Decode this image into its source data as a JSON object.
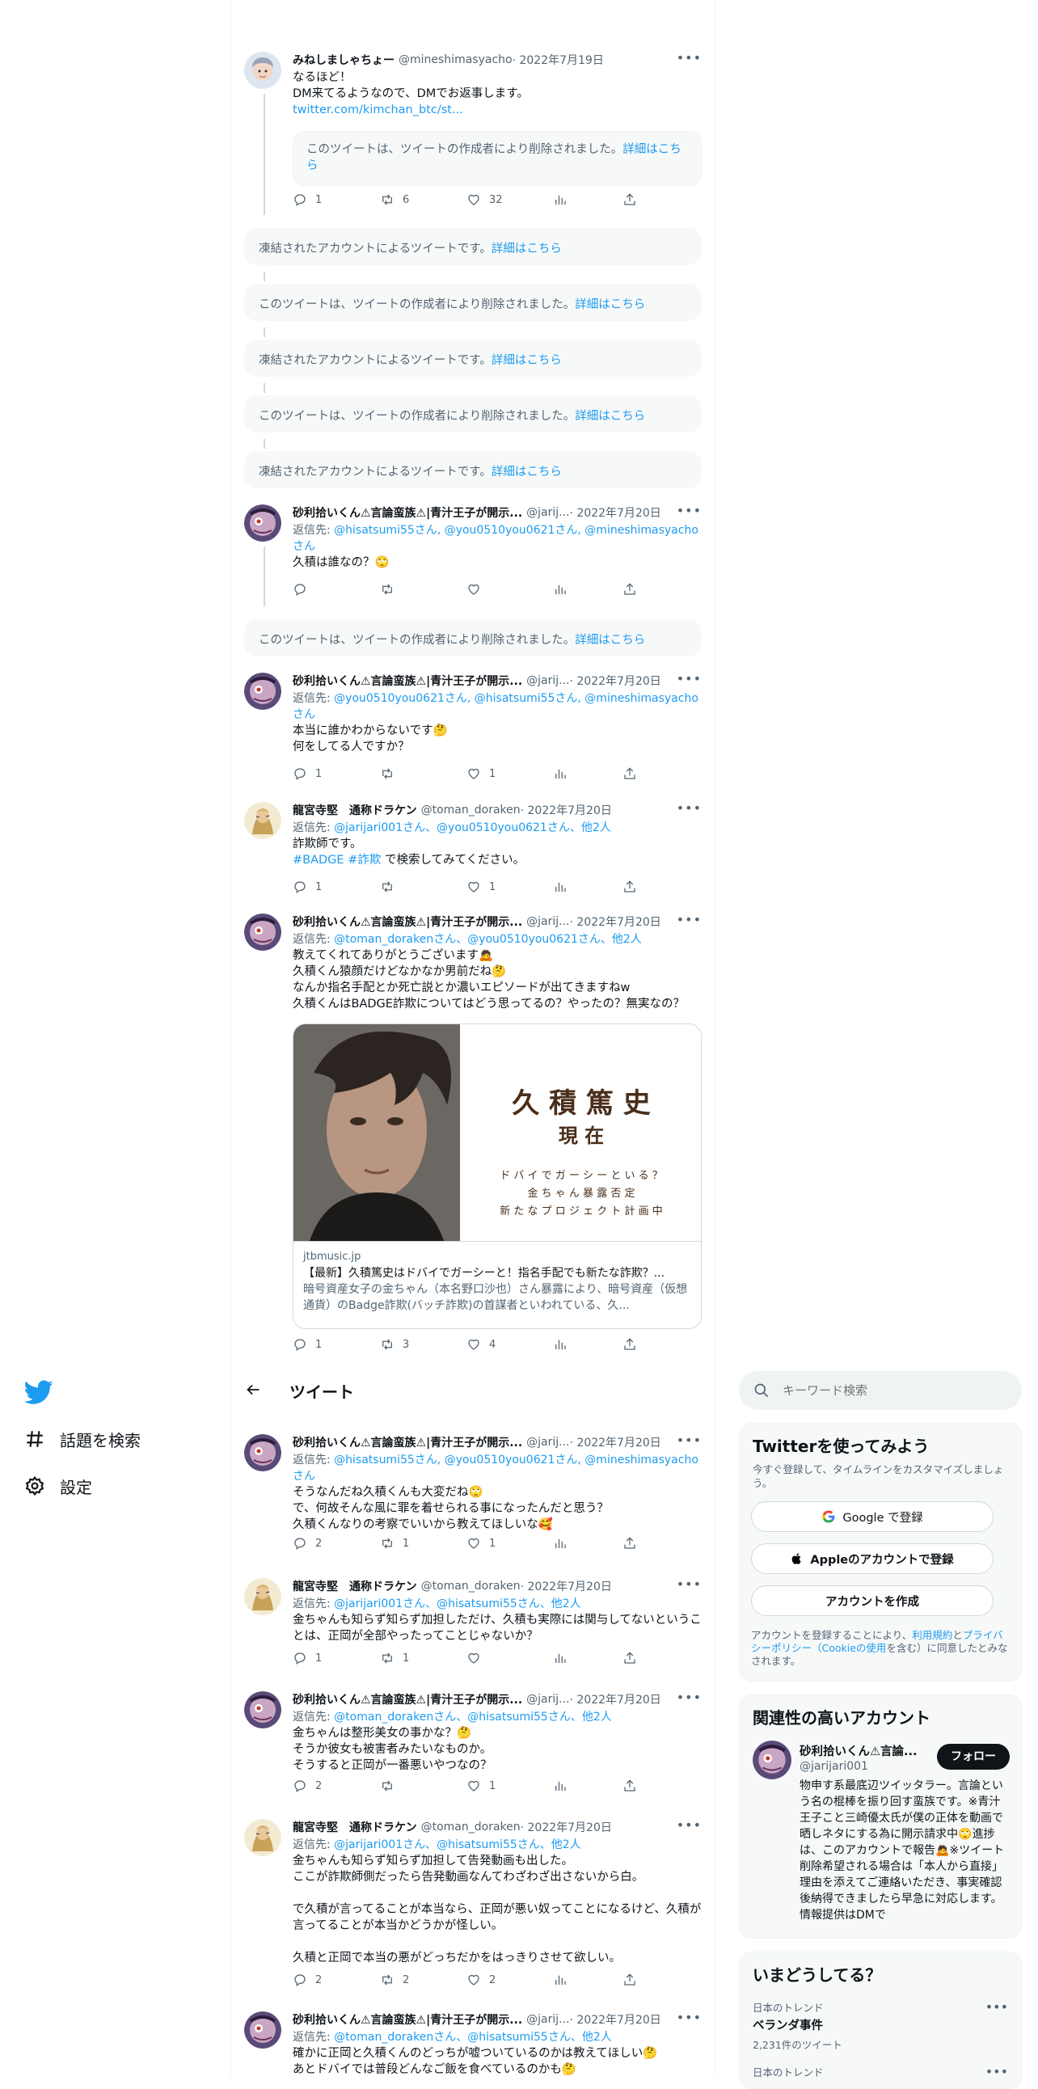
{
  "nav": {
    "explore_label": "話題を検索",
    "settings_label": "設定"
  },
  "header": {
    "title": "ツイート"
  },
  "search": {
    "placeholder": "キーワード検索"
  },
  "tweets": [
    {
      "name": "みねしましゃちょー",
      "handle": "@mineshimasyacho",
      "date": " · 2022年7月19日",
      "reply_to": "",
      "text": "なるほど！\nDM来てるようなので、DMでお返事します。",
      "link": "twitter.com/kimchan_btc/st...",
      "quoted": "このツイートは、ツイートの作成者により削除されました。",
      "quoted_link": "詳細はこちら",
      "replies": "1",
      "retweets": "6",
      "likes": "32"
    },
    {
      "name": "砂利拾いくん⚠言論蛮族⚠|青汁王子が開示...",
      "handle": "@jarij...",
      "date": " · 2022年7月20日",
      "reply_to": "@hisatsumi55さん, @you0510you0621さん, @mineshimasyachoさん",
      "text": "久積は誰なの？🙄",
      "replies": "",
      "retweets": "",
      "likes": ""
    },
    {
      "name": "砂利拾いくん⚠言論蛮族⚠|青汁王子が開示...",
      "handle": "@jarij...",
      "date": " · 2022年7月20日",
      "reply_to": "@you0510you0621さん, @hisatsumi55さん, @mineshimasyachoさん",
      "text": "本当に誰かわからないです🤔\n何をしてる人ですか？",
      "replies": "1",
      "retweets": "",
      "likes": "1"
    },
    {
      "name": "龍宮寺堅　通称ドラケン",
      "handle": "@toman_doraken",
      "date": " · 2022年7月20日",
      "reply_to": "@jarijari001さん、@you0510you0621さん、他2人",
      "text": "詐欺師です。",
      "text2": "で検索してみてください。",
      "hashtags": "#BADGE #詐欺",
      "replies": "1",
      "retweets": "",
      "likes": "1"
    },
    {
      "name": "砂利拾いくん⚠言論蛮族⚠|青汁王子が開示...",
      "handle": "@jarij...",
      "date": " · 2022年7月20日",
      "reply_to": "@toman_dorakenさん、@you0510you0621さん、他2人",
      "text": "教えてくれてありがとうございます🙇\n久積くん猿顔だけどなかなか男前だね🤔\nなんか指名手配とか死亡説とか濃いエピソードが出てきますねw\n久積くんはBADGE詐欺についてはどう思ってるの？やったの？無実なの？",
      "card": {
        "domain": "jtbmusic.jp",
        "title": "【最新】久積篤史はドバイでガーシーと！指名手配でも新たな詐欺？...",
        "desc": "暗号資産女子の金ちゃん（本名野口沙也）さん暴露により、暗号資産（仮想通貨）のBadge詐欺(バッチ詐欺)の首謀者といわれている、久...",
        "img_title": "久 積 篤 史",
        "img_sub": "現 在",
        "img_line1": "ド バ イ で ガ ー シ ー と い る ？",
        "img_line2": "金 ち ゃ ん 暴 露 否 定",
        "img_line3": "新 た な プ ロ ジ ェ ク ト 計 画 中"
      },
      "replies": "1",
      "retweets": "3",
      "likes": "4"
    },
    {
      "name": "砂利拾いくん⚠言論蛮族⚠|青汁王子が開示...",
      "handle": "@jarij...",
      "date": " · 2022年7月20日",
      "reply_to": "@hisatsumi55さん, @you0510you0621さん, @mineshimasyachoさん",
      "text": "そうなんだね久積くんも大変だね🙄\nで、何故そんな風に罪を着せられる事になったんだと思う？\n久積くんなりの考察でいいから教えてほしいな🥰",
      "replies": "2",
      "retweets": "1",
      "likes": "1"
    },
    {
      "name": "龍宮寺堅　通称ドラケン",
      "handle": "@toman_doraken",
      "date": " · 2022年7月20日",
      "reply_to": "@jarijari001さん、@hisatsumi55さん、他2人",
      "text": "金ちゃんも知らず知らず加担しただけ、久積も実際には関与してないということは、正岡が全部やったってことじゃないか？",
      "replies": "1",
      "retweets": "1",
      "likes": ""
    },
    {
      "name": "砂利拾いくん⚠言論蛮族⚠|青汁王子が開示...",
      "handle": "@jarij...",
      "date": " · 2022年7月20日",
      "reply_to": "@toman_dorakenさん、@hisatsumi55さん、他2人",
      "text": "金ちゃんは整形美女の事かな？🤔\nそうか彼女も被害者みたいなものか。\nそうすると正岡が一番悪いやつなの？",
      "replies": "2",
      "retweets": "",
      "likes": "1"
    },
    {
      "name": "龍宮寺堅　通称ドラケン",
      "handle": "@toman_doraken",
      "date": " · 2022年7月20日",
      "reply_to": "@jarijari001さん、@hisatsumi55さん、他2人",
      "text": "金ちゃんも知らず知らず加担して告発動画も出した。\nここが詐欺師側だったら告発動画なんてわざわざ出さないから白。\n\nで久積が言ってることが本当なら、正岡が悪い奴ってことになるけど、久積が言ってることが本当かどうかが怪しい。\n\n久積と正岡で本当の悪がどっちだかをはっきりさせて欲しい。",
      "replies": "2",
      "retweets": "2",
      "likes": "2"
    },
    {
      "name": "砂利拾いくん⚠言論蛮族⚠|青汁王子が開示...",
      "handle": "@jarij...",
      "date": " · 2022年7月20日",
      "reply_to": "@toman_dorakenさん、@hisatsumi55さん、他2人",
      "text": "確かに正岡と久積くんのどっちが嘘ついているのかは教えてほしい🤔\nあとドバイでは普段どんなご飯を食べているのかも🤔"
    }
  ],
  "notices": {
    "suspended": "凍結されたアカウントによるツイートです。",
    "deleted": "このツイートは、ツイートの作成者により削除されました。",
    "link": "詳細はこちら"
  },
  "signup": {
    "title": "Twitterを使ってみよう",
    "subtitle": "今すぐ登録して、タイムラインをカスタマイズしましょう。",
    "google": "Google で登録",
    "apple": "Appleのアカウントで登録",
    "create": "アカウントを作成",
    "legal_a": "アカウントを登録することにより、",
    "terms": "利用規約",
    "legal_b": "と",
    "privacy": "プライバシーポリシー（Cookieの使用",
    "legal_c": "を含む）に同意したとみなされます。"
  },
  "related": {
    "title": "関連性の高いアカウント",
    "name": "砂利拾いくん⚠言論...",
    "handle": "@jarijari001",
    "follow": "フォロー",
    "bio": "物申す系最底辺ツイッタラー。言論という名の棍棒を振り回す蛮族です。※青汁王子こと三崎優太氏が僕の正体を動画で晒しネタにする為に開示請求中🙄進捗は、このアカウントで報告🙇※ツイート削除希望される場合は「本人から直接」理由を添えてご連絡いただき、事実確認後納得できましたら早急に対応します。情報提供はDMで"
  },
  "trends": {
    "title": "いまどうしてる？",
    "items": [
      {
        "label": "日本のトレンド",
        "name": "ベランダ事件",
        "count": "2,231件のツイート"
      },
      {
        "label": "日本のトレンド",
        "name": "",
        "count": ""
      }
    ]
  },
  "colors": {
    "accent": "#1d9bf0",
    "text": "#0f1419",
    "muted": "#536471"
  }
}
